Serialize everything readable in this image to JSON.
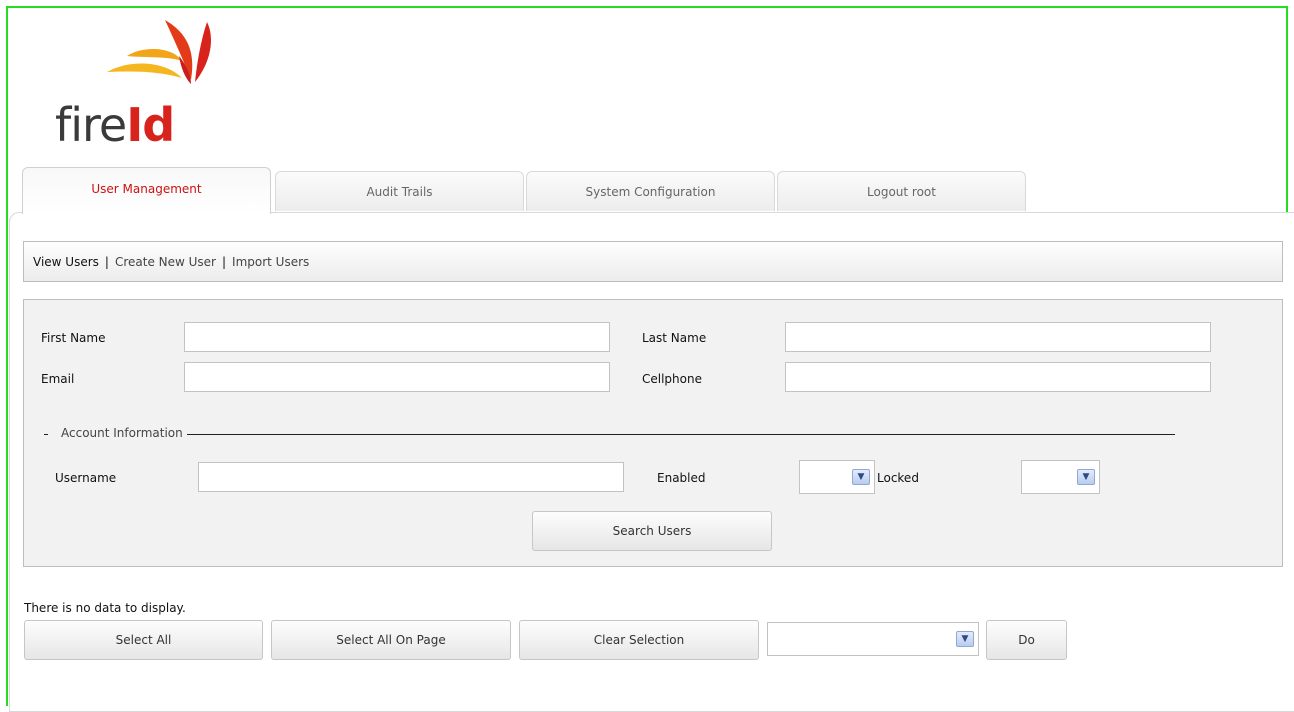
{
  "logo": {
    "fire": "fire",
    "id": "Id",
    "colors": {
      "text": "#3a3a3a",
      "accent": "#d8231d",
      "flame_orange": "#f2a51a",
      "flame_red": "#d8231d"
    }
  },
  "tabs": [
    {
      "label": "User Management",
      "active": true
    },
    {
      "label": "Audit Trails",
      "active": false
    },
    {
      "label": "System Configuration",
      "active": false
    },
    {
      "label": "Logout root",
      "active": false
    }
  ],
  "subnav": {
    "view_users": "View Users",
    "create_user": "Create New User",
    "import_users": "Import Users",
    "separator": "|"
  },
  "search_form": {
    "first_name_label": "First Name",
    "first_name_value": "",
    "last_name_label": "Last Name",
    "last_name_value": "",
    "email_label": "Email",
    "email_value": "",
    "cellphone_label": "Cellphone",
    "cellphone_value": "",
    "account_info_legend": "Account Information",
    "username_label": "Username",
    "username_value": "",
    "enabled_label": "Enabled",
    "enabled_value": "",
    "locked_label": "Locked",
    "locked_value": "",
    "search_button": "Search Users"
  },
  "results": {
    "empty_message": "There is no data to display.",
    "select_all": "Select All",
    "select_all_on_page": "Select All On Page",
    "clear_selection": "Clear Selection",
    "action_value": "",
    "do_button": "Do"
  },
  "colors": {
    "frame_border": "#22dd22",
    "active_tab_text": "#cc1111",
    "form_background": "#f2f2f2"
  }
}
